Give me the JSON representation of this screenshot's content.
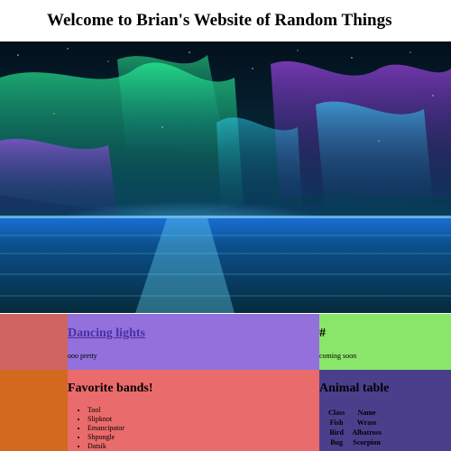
{
  "header": {
    "title": "Welcome to Brian's Website of Random Things"
  },
  "hero": {
    "description_icon": "aurora-image"
  },
  "cards": {
    "dancing": {
      "title": "Dancing lights",
      "text": "ooo pretty"
    },
    "hash": {
      "title": "#",
      "text": "coming soon"
    }
  },
  "bands": {
    "title": "Favorite bands!",
    "items": [
      "Tool",
      "Slipknot",
      "Emancipator",
      "Shpongle",
      "Datsik"
    ]
  },
  "animals": {
    "title": "Animal table",
    "headers": [
      "Class",
      "Name"
    ],
    "rows": [
      [
        "Fish",
        "Wrass"
      ],
      [
        "Bird",
        "Albatross"
      ],
      [
        "Bug",
        "Scorpion"
      ]
    ]
  },
  "colors": {
    "left_top": "#d06463",
    "mid_top": "#9370db",
    "right_top": "#8ae66a",
    "left_bottom": "#d2691e",
    "mid_bottom": "#ea6b6b",
    "right_bottom": "#4b3f8c"
  }
}
